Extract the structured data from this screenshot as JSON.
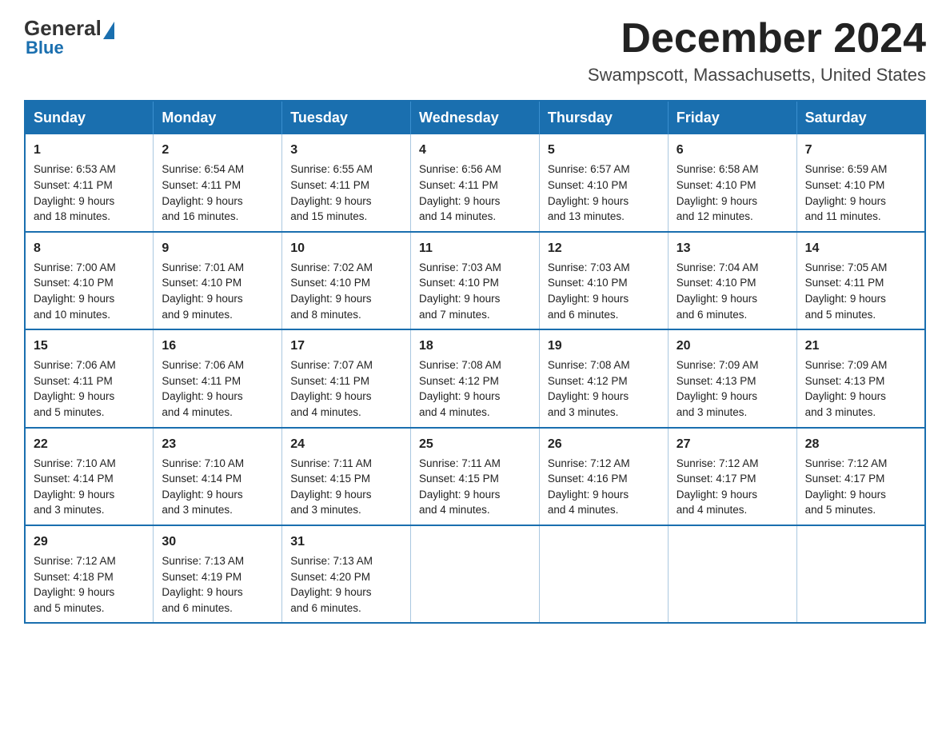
{
  "logo": {
    "general": "General",
    "blue": "Blue"
  },
  "header": {
    "month_year": "December 2024",
    "location": "Swampscott, Massachusetts, United States"
  },
  "days_of_week": [
    "Sunday",
    "Monday",
    "Tuesday",
    "Wednesday",
    "Thursday",
    "Friday",
    "Saturday"
  ],
  "weeks": [
    [
      {
        "day": "1",
        "sunrise": "6:53 AM",
        "sunset": "4:11 PM",
        "daylight": "9 hours and 18 minutes."
      },
      {
        "day": "2",
        "sunrise": "6:54 AM",
        "sunset": "4:11 PM",
        "daylight": "9 hours and 16 minutes."
      },
      {
        "day": "3",
        "sunrise": "6:55 AM",
        "sunset": "4:11 PM",
        "daylight": "9 hours and 15 minutes."
      },
      {
        "day": "4",
        "sunrise": "6:56 AM",
        "sunset": "4:11 PM",
        "daylight": "9 hours and 14 minutes."
      },
      {
        "day": "5",
        "sunrise": "6:57 AM",
        "sunset": "4:10 PM",
        "daylight": "9 hours and 13 minutes."
      },
      {
        "day": "6",
        "sunrise": "6:58 AM",
        "sunset": "4:10 PM",
        "daylight": "9 hours and 12 minutes."
      },
      {
        "day": "7",
        "sunrise": "6:59 AM",
        "sunset": "4:10 PM",
        "daylight": "9 hours and 11 minutes."
      }
    ],
    [
      {
        "day": "8",
        "sunrise": "7:00 AM",
        "sunset": "4:10 PM",
        "daylight": "9 hours and 10 minutes."
      },
      {
        "day": "9",
        "sunrise": "7:01 AM",
        "sunset": "4:10 PM",
        "daylight": "9 hours and 9 minutes."
      },
      {
        "day": "10",
        "sunrise": "7:02 AM",
        "sunset": "4:10 PM",
        "daylight": "9 hours and 8 minutes."
      },
      {
        "day": "11",
        "sunrise": "7:03 AM",
        "sunset": "4:10 PM",
        "daylight": "9 hours and 7 minutes."
      },
      {
        "day": "12",
        "sunrise": "7:03 AM",
        "sunset": "4:10 PM",
        "daylight": "9 hours and 6 minutes."
      },
      {
        "day": "13",
        "sunrise": "7:04 AM",
        "sunset": "4:10 PM",
        "daylight": "9 hours and 6 minutes."
      },
      {
        "day": "14",
        "sunrise": "7:05 AM",
        "sunset": "4:11 PM",
        "daylight": "9 hours and 5 minutes."
      }
    ],
    [
      {
        "day": "15",
        "sunrise": "7:06 AM",
        "sunset": "4:11 PM",
        "daylight": "9 hours and 5 minutes."
      },
      {
        "day": "16",
        "sunrise": "7:06 AM",
        "sunset": "4:11 PM",
        "daylight": "9 hours and 4 minutes."
      },
      {
        "day": "17",
        "sunrise": "7:07 AM",
        "sunset": "4:11 PM",
        "daylight": "9 hours and 4 minutes."
      },
      {
        "day": "18",
        "sunrise": "7:08 AM",
        "sunset": "4:12 PM",
        "daylight": "9 hours and 4 minutes."
      },
      {
        "day": "19",
        "sunrise": "7:08 AM",
        "sunset": "4:12 PM",
        "daylight": "9 hours and 3 minutes."
      },
      {
        "day": "20",
        "sunrise": "7:09 AM",
        "sunset": "4:13 PM",
        "daylight": "9 hours and 3 minutes."
      },
      {
        "day": "21",
        "sunrise": "7:09 AM",
        "sunset": "4:13 PM",
        "daylight": "9 hours and 3 minutes."
      }
    ],
    [
      {
        "day": "22",
        "sunrise": "7:10 AM",
        "sunset": "4:14 PM",
        "daylight": "9 hours and 3 minutes."
      },
      {
        "day": "23",
        "sunrise": "7:10 AM",
        "sunset": "4:14 PM",
        "daylight": "9 hours and 3 minutes."
      },
      {
        "day": "24",
        "sunrise": "7:11 AM",
        "sunset": "4:15 PM",
        "daylight": "9 hours and 3 minutes."
      },
      {
        "day": "25",
        "sunrise": "7:11 AM",
        "sunset": "4:15 PM",
        "daylight": "9 hours and 4 minutes."
      },
      {
        "day": "26",
        "sunrise": "7:12 AM",
        "sunset": "4:16 PM",
        "daylight": "9 hours and 4 minutes."
      },
      {
        "day": "27",
        "sunrise": "7:12 AM",
        "sunset": "4:17 PM",
        "daylight": "9 hours and 4 minutes."
      },
      {
        "day": "28",
        "sunrise": "7:12 AM",
        "sunset": "4:17 PM",
        "daylight": "9 hours and 5 minutes."
      }
    ],
    [
      {
        "day": "29",
        "sunrise": "7:12 AM",
        "sunset": "4:18 PM",
        "daylight": "9 hours and 5 minutes."
      },
      {
        "day": "30",
        "sunrise": "7:13 AM",
        "sunset": "4:19 PM",
        "daylight": "9 hours and 6 minutes."
      },
      {
        "day": "31",
        "sunrise": "7:13 AM",
        "sunset": "4:20 PM",
        "daylight": "9 hours and 6 minutes."
      },
      null,
      null,
      null,
      null
    ]
  ],
  "labels": {
    "sunrise": "Sunrise:",
    "sunset": "Sunset:",
    "daylight": "Daylight:"
  }
}
